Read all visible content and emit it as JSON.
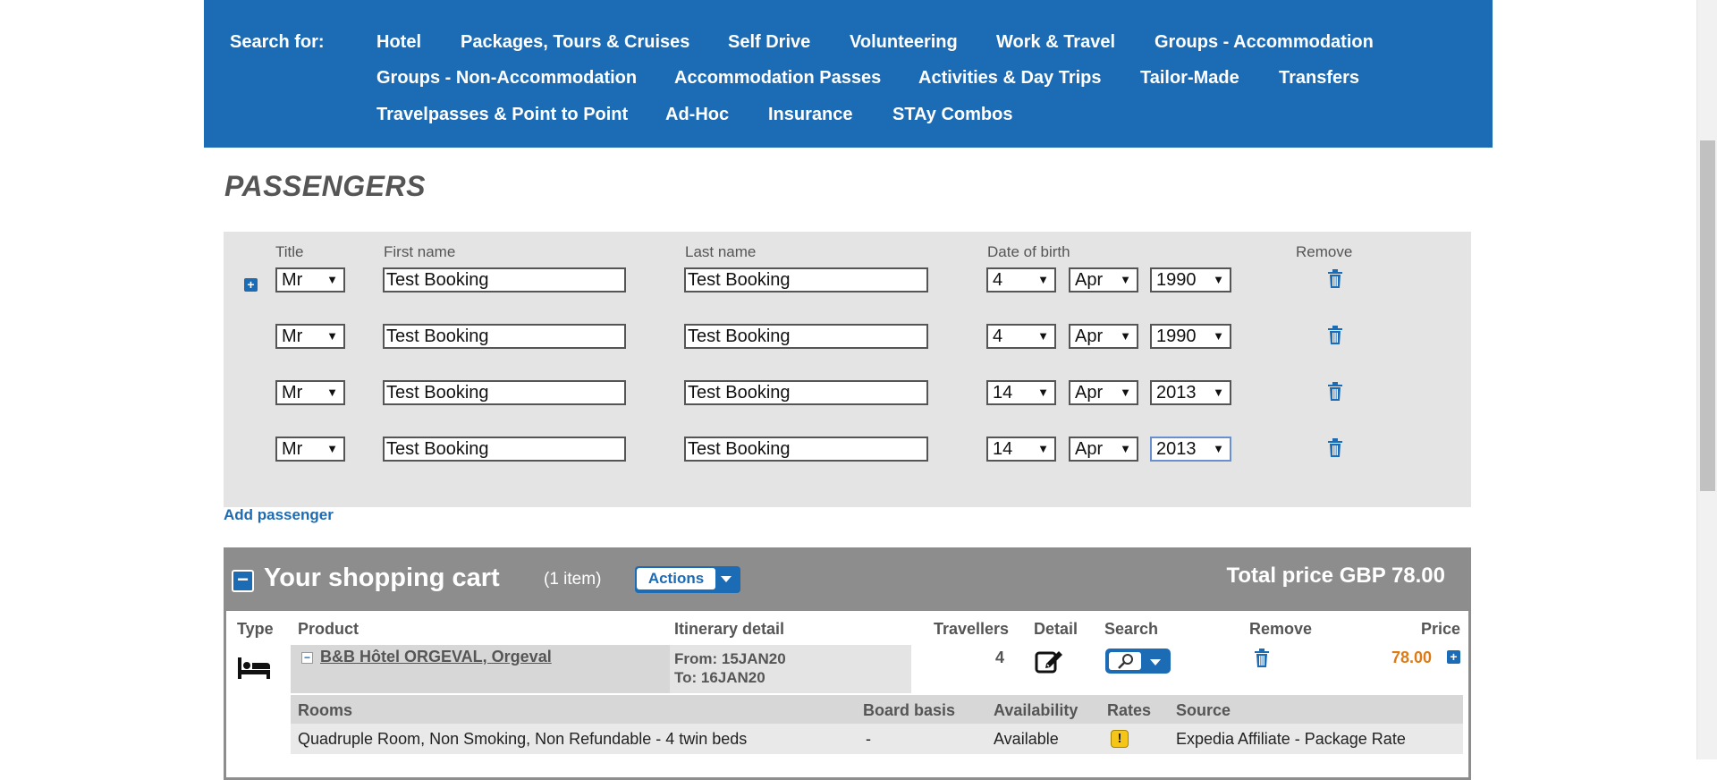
{
  "nav": {
    "label": "Search for:",
    "items": [
      "Hotel",
      "Packages, Tours & Cruises",
      "Self Drive",
      "Volunteering",
      "Work & Travel",
      "Groups - Accommodation",
      "Groups - Non-Accommodation",
      "Accommodation Passes",
      "Activities & Day Trips",
      "Tailor-Made",
      "Transfers",
      "Travelpasses & Point to Point",
      "Ad-Hoc",
      "Insurance",
      "STAy Combos"
    ]
  },
  "passengers": {
    "title": "PASSENGERS",
    "headers": {
      "title": "Title",
      "first": "First name",
      "last": "Last name",
      "dob": "Date of birth",
      "remove": "Remove"
    },
    "rows": [
      {
        "title": "Mr",
        "first": "Test Booking",
        "last": "Test Booking",
        "day": "4",
        "month": "Apr",
        "year": "1990"
      },
      {
        "title": "Mr",
        "first": "Test Booking",
        "last": "Test Booking",
        "day": "4",
        "month": "Apr",
        "year": "1990"
      },
      {
        "title": "Mr",
        "first": "Test Booking",
        "last": "Test Booking",
        "day": "14",
        "month": "Apr",
        "year": "2013"
      },
      {
        "title": "Mr",
        "first": "Test Booking",
        "last": "Test Booking",
        "day": "14",
        "month": "Apr",
        "year": "2013"
      }
    ],
    "add_label": "Add passenger"
  },
  "cart": {
    "title": "Your shopping cart",
    "count": "(1 item)",
    "actions_label": "Actions",
    "total": "Total price GBP 78.00",
    "headers": {
      "type": "Type",
      "product": "Product",
      "itinerary": "Itinerary detail",
      "travellers": "Travellers",
      "detail": "Detail",
      "search": "Search",
      "remove": "Remove",
      "price": "Price"
    },
    "item": {
      "product": "B&B Hôtel ORGEVAL, Orgeval",
      "from": "From: 15JAN20",
      "to": "To: 16JAN20",
      "travellers": "4",
      "price": "78.00"
    },
    "rooms_headers": {
      "rooms": "Rooms",
      "board": "Board basis",
      "availability": "Availability",
      "rates": "Rates",
      "source": "Source"
    },
    "room": {
      "rooms": "Quadruple Room, Non Smoking, Non Refundable - 4 twin beds",
      "board": "-",
      "availability": "Available",
      "rates": "!",
      "source": "Expedia Affiliate - Package Rate"
    }
  },
  "colors": {
    "brand_blue": "#1c6bb5",
    "cart_header_gray": "#8d8d8d",
    "price_orange": "#e07b14",
    "warning_yellow": "#f5c518"
  }
}
